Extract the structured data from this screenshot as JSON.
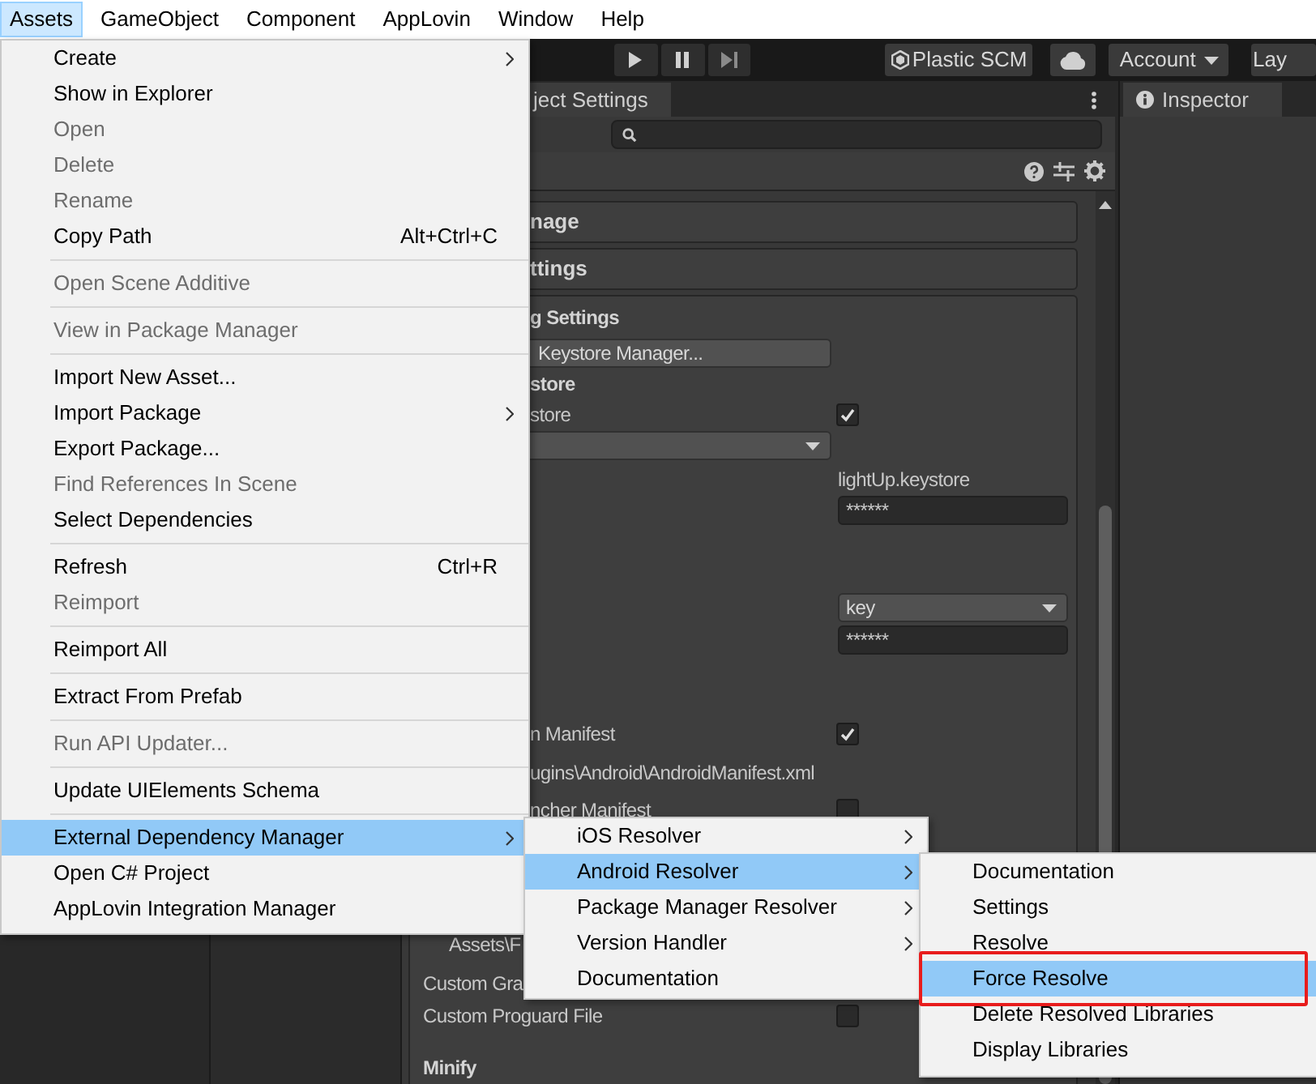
{
  "menubar": {
    "items": [
      {
        "label": "Assets",
        "selected": true
      },
      {
        "label": "GameObject",
        "selected": false
      },
      {
        "label": "Component",
        "selected": false
      },
      {
        "label": "AppLovin",
        "selected": false
      },
      {
        "label": "Window",
        "selected": false
      },
      {
        "label": "Help",
        "selected": false
      }
    ]
  },
  "toolbar": {
    "buttons": [
      "Plastic SCM",
      "Account",
      "Lay"
    ]
  },
  "project_settings": {
    "tab": "ject Settings",
    "foldouts": [
      "nage",
      "ttings"
    ],
    "rows": [
      {
        "kind": "section",
        "label": "g Settings"
      },
      {
        "kind": "button",
        "label": "Keystore Manager..."
      },
      {
        "kind": "section",
        "label": "store"
      },
      {
        "kind": "toggle",
        "label": "store",
        "checked": true
      },
      {
        "kind": "wide_dropdown"
      },
      {
        "kind": "value",
        "value": "lightUp.keystore"
      },
      {
        "kind": "password",
        "value": "******"
      },
      {
        "kind": "dropdown",
        "value": "key"
      },
      {
        "kind": "password",
        "value": "******"
      },
      {
        "kind": "toggle",
        "label": "n Manifest",
        "checked": true
      },
      {
        "kind": "path",
        "label": "ugins\\Android\\AndroidManifest.xml"
      },
      {
        "kind": "toggle",
        "label": "ncher Manifest",
        "checked": false
      },
      {
        "kind": "path",
        "label": "Assets\\F"
      },
      {
        "kind": "text",
        "label": "Custom Gra"
      },
      {
        "kind": "toggle",
        "label": "Custom Proguard File",
        "checked": false
      },
      {
        "kind": "section",
        "label": "Minify"
      }
    ]
  },
  "inspector": {
    "tab": "Inspector"
  },
  "assets_menu": {
    "items": [
      {
        "kind": "item",
        "label": "Create",
        "submenu": true,
        "disabled": false,
        "selected": false
      },
      {
        "kind": "item",
        "label": "Show in Explorer",
        "submenu": false,
        "disabled": false,
        "selected": false
      },
      {
        "kind": "item",
        "label": "Open",
        "submenu": false,
        "disabled": true,
        "selected": false
      },
      {
        "kind": "item",
        "label": "Delete",
        "submenu": false,
        "disabled": true,
        "selected": false
      },
      {
        "kind": "item",
        "label": "Rename",
        "submenu": false,
        "disabled": true,
        "selected": false
      },
      {
        "kind": "item",
        "label": "Copy Path",
        "shortcut": "Alt+Ctrl+C",
        "submenu": false,
        "disabled": false,
        "selected": false
      },
      {
        "kind": "separator"
      },
      {
        "kind": "item",
        "label": "Open Scene Additive",
        "submenu": false,
        "disabled": true,
        "selected": false
      },
      {
        "kind": "separator"
      },
      {
        "kind": "item",
        "label": "View in Package Manager",
        "submenu": false,
        "disabled": true,
        "selected": false
      },
      {
        "kind": "separator"
      },
      {
        "kind": "item",
        "label": "Import New Asset...",
        "submenu": false,
        "disabled": false,
        "selected": false
      },
      {
        "kind": "item",
        "label": "Import Package",
        "submenu": true,
        "disabled": false,
        "selected": false
      },
      {
        "kind": "item",
        "label": "Export Package...",
        "submenu": false,
        "disabled": false,
        "selected": false
      },
      {
        "kind": "item",
        "label": "Find References In Scene",
        "submenu": false,
        "disabled": true,
        "selected": false
      },
      {
        "kind": "item",
        "label": "Select Dependencies",
        "submenu": false,
        "disabled": false,
        "selected": false
      },
      {
        "kind": "separator"
      },
      {
        "kind": "item",
        "label": "Refresh",
        "shortcut": "Ctrl+R",
        "submenu": false,
        "disabled": false,
        "selected": false
      },
      {
        "kind": "item",
        "label": "Reimport",
        "submenu": false,
        "disabled": true,
        "selected": false
      },
      {
        "kind": "separator"
      },
      {
        "kind": "item",
        "label": "Reimport All",
        "submenu": false,
        "disabled": false,
        "selected": false
      },
      {
        "kind": "separator"
      },
      {
        "kind": "item",
        "label": "Extract From Prefab",
        "submenu": false,
        "disabled": false,
        "selected": false
      },
      {
        "kind": "separator"
      },
      {
        "kind": "item",
        "label": "Run API Updater...",
        "submenu": false,
        "disabled": true,
        "selected": false
      },
      {
        "kind": "separator"
      },
      {
        "kind": "item",
        "label": "Update UIElements Schema",
        "submenu": false,
        "disabled": false,
        "selected": false
      },
      {
        "kind": "separator"
      },
      {
        "kind": "item",
        "label": "External Dependency Manager",
        "submenu": true,
        "disabled": false,
        "selected": true
      },
      {
        "kind": "item",
        "label": "Open C# Project",
        "submenu": false,
        "disabled": false,
        "selected": false
      },
      {
        "kind": "item",
        "label": "AppLovin Integration Manager",
        "submenu": false,
        "disabled": false,
        "selected": false
      }
    ]
  },
  "dependency_menu": {
    "items": [
      {
        "kind": "item",
        "label": "iOS Resolver",
        "submenu": true,
        "disabled": false,
        "selected": false
      },
      {
        "kind": "item",
        "label": "Android Resolver",
        "submenu": true,
        "disabled": false,
        "selected": true
      },
      {
        "kind": "item",
        "label": "Package Manager Resolver",
        "submenu": true,
        "disabled": false,
        "selected": false
      },
      {
        "kind": "item",
        "label": "Version Handler",
        "submenu": true,
        "disabled": false,
        "selected": false
      },
      {
        "kind": "item",
        "label": "Documentation",
        "submenu": false,
        "disabled": false,
        "selected": false
      }
    ]
  },
  "android_menu": {
    "items": [
      {
        "kind": "item",
        "label": "Documentation",
        "submenu": false,
        "disabled": false,
        "selected": false,
        "highlighted": false
      },
      {
        "kind": "item",
        "label": "Settings",
        "submenu": false,
        "disabled": false,
        "selected": false,
        "highlighted": false
      },
      {
        "kind": "item",
        "label": "Resolve",
        "submenu": false,
        "disabled": false,
        "selected": false,
        "highlighted": false
      },
      {
        "kind": "item",
        "label": "Force Resolve",
        "submenu": false,
        "disabled": false,
        "selected": true,
        "highlighted": true
      },
      {
        "kind": "item",
        "label": "Delete Resolved Libraries",
        "submenu": false,
        "disabled": false,
        "selected": false,
        "highlighted": false
      },
      {
        "kind": "item",
        "label": "Display Libraries",
        "submenu": false,
        "disabled": false,
        "selected": false,
        "highlighted": false
      }
    ]
  }
}
